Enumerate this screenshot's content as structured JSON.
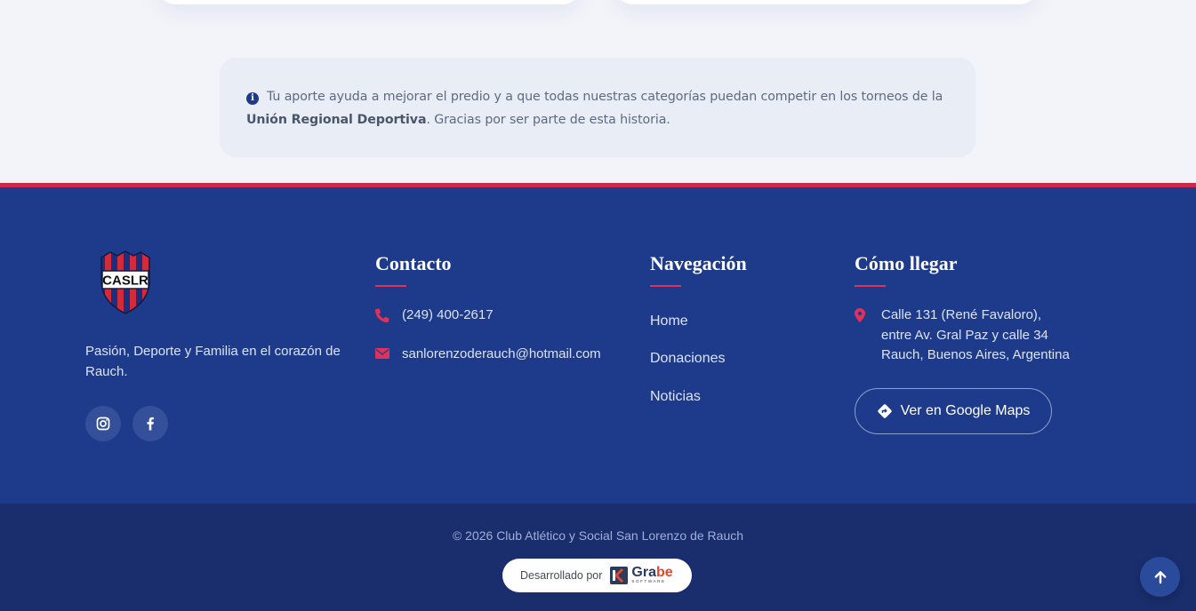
{
  "info": {
    "text_before": "Tu aporte ayuda a mejorar el predio y a que todas nuestras categorías puedan competir en los torneos de la",
    "text_bold": "Unión Regional Deportiva",
    "text_after": ". Gracias por ser parte de esta historia."
  },
  "brand": {
    "logo_text": "CASLR",
    "tagline": "Pasión, Deporte y Familia en el corazón de Rauch."
  },
  "social": [
    {
      "icon": "instagram-icon"
    },
    {
      "icon": "facebook-icon"
    }
  ],
  "contact": {
    "title": "Contacto",
    "phone": "(249) 400-2617",
    "email": "sanlorenzoderauch@hotmail.com"
  },
  "navigation": {
    "title": "Navegación",
    "items": [
      {
        "label": "Home"
      },
      {
        "label": "Donaciones"
      },
      {
        "label": "Noticias"
      }
    ]
  },
  "directions": {
    "title": "Cómo llegar",
    "address_lines": [
      "Calle 131 (René Favaloro),",
      "entre Av. Gral Paz y calle 34",
      "Rauch, Buenos Aires, Argentina"
    ],
    "maps_button": "Ver en Google Maps"
  },
  "footer": {
    "copyright": "© 2026 Club Atlético y Social San Lorenzo de Rauch",
    "developed_by": "Desarrollado por",
    "developer_name_a": "Gra",
    "developer_name_b": "be",
    "developer_sub": "SOFTWARE"
  },
  "colors": {
    "primary": "#1e3a8a",
    "accent": "#e0315a",
    "footer_bottom": "#1a2e6e"
  }
}
